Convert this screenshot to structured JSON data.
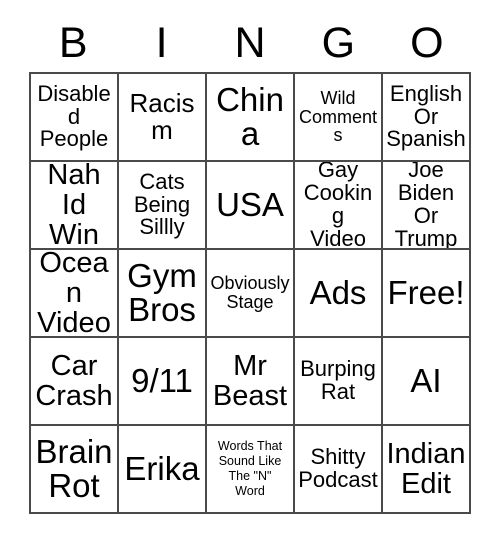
{
  "card": {
    "headers": [
      "B",
      "I",
      "N",
      "G",
      "O"
    ],
    "rows": [
      [
        {
          "text": "Disabled\nPeople",
          "size": "md"
        },
        {
          "text": "Racism",
          "size": "lg"
        },
        {
          "text": "China",
          "size": "xxl"
        },
        {
          "text": "Wild\nComments",
          "size": "sm"
        },
        {
          "text": "English\nOr\nSpanish",
          "size": "md"
        }
      ],
      [
        {
          "text": "Nah\nId Win",
          "size": "xl"
        },
        {
          "text": "Cats\nBeing\nSillly",
          "size": "md"
        },
        {
          "text": "USA",
          "size": "xxl"
        },
        {
          "text": "Gay\nCooking\nVideo",
          "size": "md"
        },
        {
          "text": "Joe\nBiden Or\nTrump",
          "size": "md"
        }
      ],
      [
        {
          "text": "Ocean\nVideo",
          "size": "xl"
        },
        {
          "text": "Gym\nBros",
          "size": "xxl"
        },
        {
          "text": "Obviously\nStage",
          "size": "sm"
        },
        {
          "text": "Ads",
          "size": "xxl"
        },
        {
          "text": "Free!",
          "size": "xxl"
        }
      ],
      [
        {
          "text": "Car\nCrash",
          "size": "xl"
        },
        {
          "text": "9/11",
          "size": "xxl"
        },
        {
          "text": "Mr\nBeast",
          "size": "xl"
        },
        {
          "text": "Burping\nRat",
          "size": "md"
        },
        {
          "text": "AI",
          "size": "xxl"
        }
      ],
      [
        {
          "text": "Brain\nRot",
          "size": "xxl"
        },
        {
          "text": "Erika",
          "size": "xxl"
        },
        {
          "text": "Words That\nSound Like\nThe \"N\"\nWord",
          "size": "xxs"
        },
        {
          "text": "Shitty\nPodcast",
          "size": "md"
        },
        {
          "text": "Indian\nEdit",
          "size": "xl"
        }
      ]
    ]
  },
  "colors": {
    "grid_line": "#4a4a4a",
    "text": "#000000",
    "background": "#ffffff"
  }
}
